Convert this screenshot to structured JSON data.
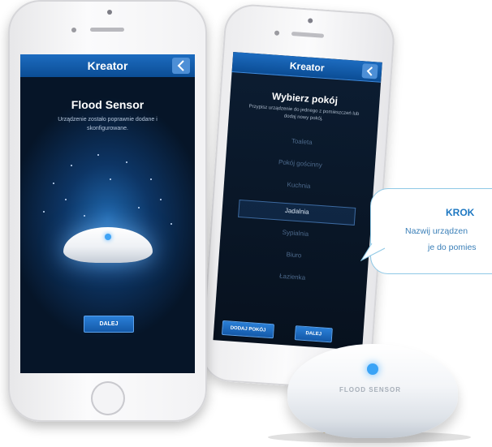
{
  "phone_front": {
    "nav_title": "Kreator",
    "heading": "Flood Sensor",
    "subtext": "Urządzenie zostało poprawnie dodane i skonfigurowane.",
    "button_label": "DALEJ"
  },
  "phone_back": {
    "nav_title": "Kreator",
    "heading": "Wybierz pokój",
    "subtext": "Przypisz urządzenie do jednego z pomieszczeń lub dodaj nowy pokój.",
    "rooms": [
      "Toaleta",
      "Pokój gościnny",
      "Kuchnia",
      "Jadalnia",
      "Sypialnia",
      "Biuro",
      "Łazienka"
    ],
    "selected_room": "Jadalnia",
    "add_room_button": "DODAJ POKÓJ",
    "next_button": "DALEJ"
  },
  "callout": {
    "title": "KROK",
    "line1": "Nazwij urządzen",
    "line2": "je do pomies"
  },
  "device_label": "FLOOD SENSOR"
}
